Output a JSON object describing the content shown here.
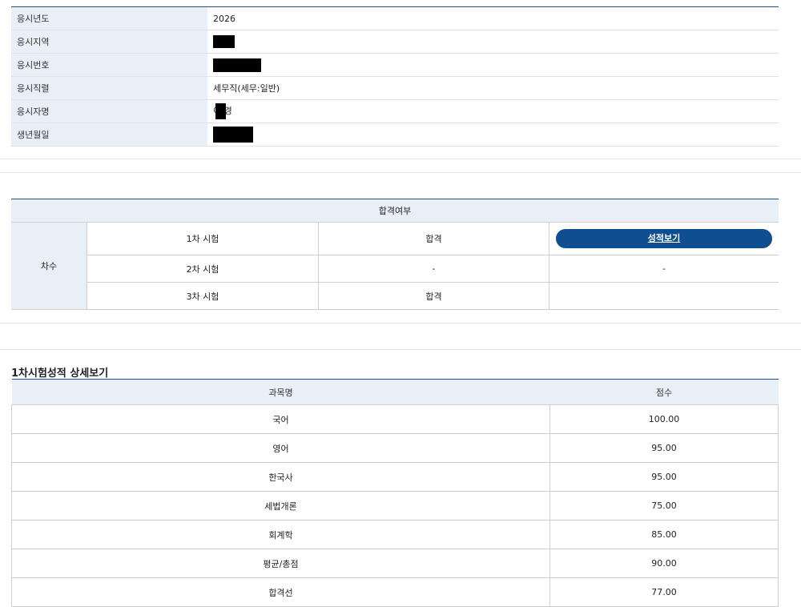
{
  "applicant_info": [
    {
      "label": "응시년도",
      "value": "2026"
    },
    {
      "label": "응시지역",
      "value": ""
    },
    {
      "label": "응시번호",
      "value": ""
    },
    {
      "label": "응시직렬",
      "value": "세무직(세무:일반)"
    },
    {
      "label": "응시자명",
      "value": "이 경"
    },
    {
      "label": "생년월일",
      "value": ""
    }
  ],
  "pass_result": {
    "header": "합격여부",
    "row_header": "차수",
    "rows": [
      {
        "round": "1차 시험",
        "result": "합격",
        "action": "성적보기"
      },
      {
        "round": "2차 시험",
        "result": "-",
        "action": "-"
      },
      {
        "round": "3차 시험",
        "result": "합격",
        "action": ""
      }
    ]
  },
  "score_detail": {
    "title": "1차시험성적 상세보기",
    "col_subject": "과목명",
    "col_score": "점수",
    "rows": [
      {
        "subject": "국어",
        "score": "100.00"
      },
      {
        "subject": "영어",
        "score": "95.00"
      },
      {
        "subject": "한국사",
        "score": "95.00"
      },
      {
        "subject": "세법개론",
        "score": "75.00"
      },
      {
        "subject": "회계학",
        "score": "85.00"
      },
      {
        "subject": "평균/총점",
        "score": "90.00"
      },
      {
        "subject": "합격선",
        "score": "77.00"
      }
    ]
  }
}
